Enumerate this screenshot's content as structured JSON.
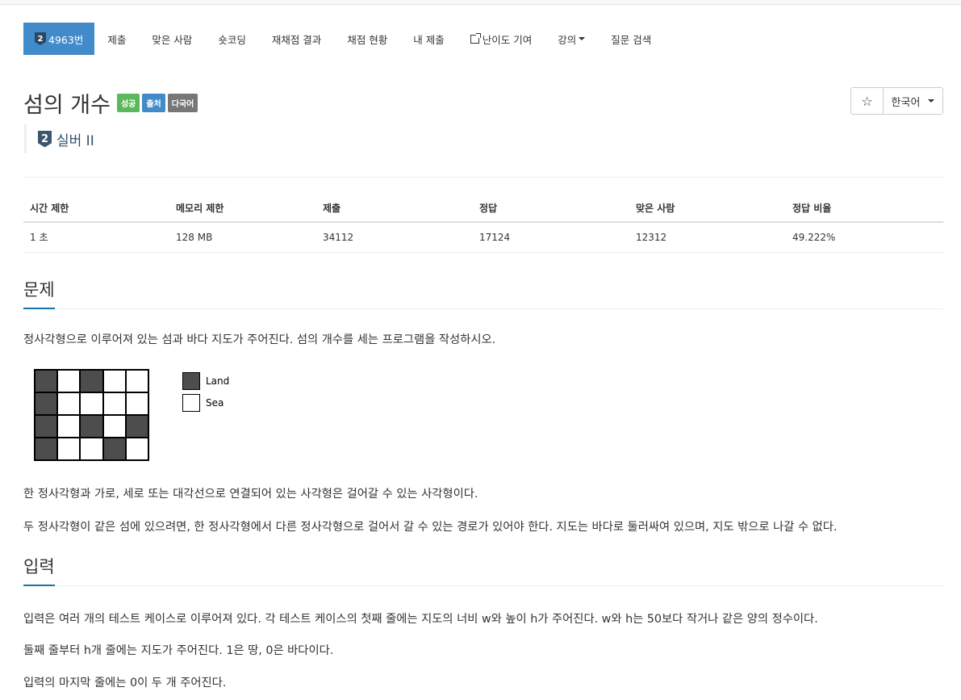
{
  "nav": {
    "problem_id_tab": "4963번",
    "tier_badge_text": "2",
    "tabs": [
      "제출",
      "맞은 사람",
      "숏코딩",
      "재채점 결과",
      "채점 현황",
      "내 제출",
      "난이도 기여",
      "강의",
      "질문 검색"
    ]
  },
  "problem": {
    "title": "섬의 개수",
    "labels": [
      "성공",
      "출처",
      "다국어"
    ],
    "tier": "실버 II",
    "tier_num": "2",
    "star": "☆",
    "language": "한국어"
  },
  "info_table": {
    "headers": [
      "시간 제한",
      "메모리 제한",
      "제출",
      "정답",
      "맞은 사람",
      "정답 비율"
    ],
    "values": [
      "1 초",
      "128 MB",
      "34112",
      "17124",
      "12312",
      "49.222%"
    ]
  },
  "sections": {
    "problem_heading": "문제",
    "problem_text_1": "정사각형으로 이루어져 있는 섬과 바다 지도가 주어진다. 섬의 개수를 세는 프로그램을 작성하시오.",
    "problem_text_2": "한 정사각형과 가로, 세로 또는 대각선으로 연결되어 있는 사각형은 걸어갈 수 있는 사각형이다.",
    "problem_text_3": "두 정사각형이 같은 섬에 있으려면, 한 정사각형에서 다른 정사각형으로 걸어서 갈 수 있는 경로가 있어야 한다. 지도는 바다로 둘러싸여 있으며, 지도 밖으로 나갈 수 없다.",
    "input_heading": "입력",
    "input_text_1": "입력은 여러 개의 테스트 케이스로 이루어져 있다. 각 테스트 케이스의 첫째 줄에는 지도의 너비 w와 높이 h가 주어진다. w와 h는 50보다 작거나 같은 양의 정수이다.",
    "input_text_2": "둘째 줄부터 h개 줄에는 지도가 주어진다. 1은 땅, 0은 바다이다.",
    "input_text_3": "입력의 마지막 줄에는 0이 두 개 주어진다."
  },
  "figure": {
    "map": [
      [
        1,
        0,
        1,
        0,
        0
      ],
      [
        1,
        0,
        0,
        0,
        0
      ],
      [
        1,
        0,
        1,
        0,
        1
      ],
      [
        1,
        0,
        0,
        1,
        0
      ]
    ],
    "legend_land": "Land",
    "legend_sea": "Sea",
    "land_color": "#4d4d4d",
    "sea_color": "#ffffff"
  }
}
